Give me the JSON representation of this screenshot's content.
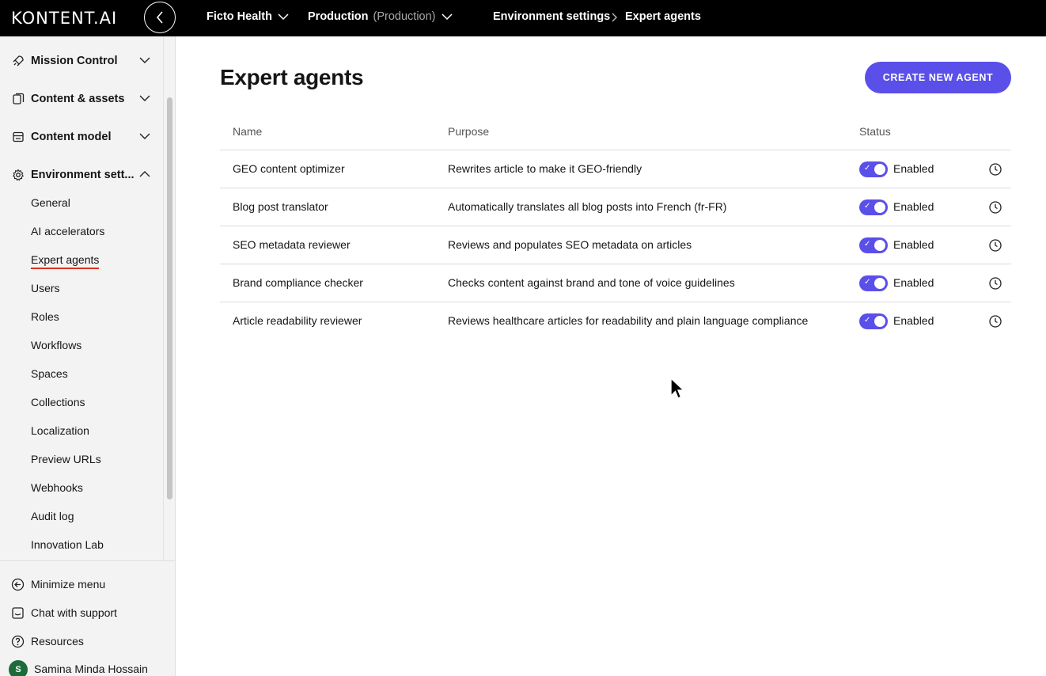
{
  "header": {
    "logo": "KONTENT.AI",
    "project": "Ficto Health",
    "environment": "Production",
    "environment_type": "(Production)",
    "breadcrumb": [
      "Environment settings",
      "Expert agents"
    ]
  },
  "sidebar": {
    "groups": [
      {
        "label": "Mission Control",
        "icon": "rocket-icon",
        "expanded": false
      },
      {
        "label": "Content & assets",
        "icon": "files-icon",
        "expanded": false
      },
      {
        "label": "Content model",
        "icon": "model-icon",
        "expanded": false
      },
      {
        "label": "Environment sett...",
        "icon": "gear-icon",
        "expanded": true
      }
    ],
    "sub_items": [
      "General",
      "AI accelerators",
      "Expert agents",
      "Users",
      "Roles",
      "Workflows",
      "Spaces",
      "Collections",
      "Localization",
      "Preview URLs",
      "Webhooks",
      "Audit log",
      "Innovation Lab"
    ],
    "active_item": "Expert agents",
    "bottom": [
      {
        "label": "Minimize menu",
        "icon": "arrow-left-circle-icon"
      },
      {
        "label": "Chat with support",
        "icon": "chat-icon"
      },
      {
        "label": "Resources",
        "icon": "question-circle-icon"
      }
    ],
    "user": {
      "initial": "S",
      "name": "Samina Minda Hossain"
    }
  },
  "main": {
    "title": "Expert agents",
    "create_button": "CREATE NEW AGENT",
    "columns": [
      "Name",
      "Purpose",
      "Status"
    ],
    "rows": [
      {
        "name": "GEO content optimizer",
        "purpose": "Rewrites article to make it GEO-friendly",
        "status": "Enabled"
      },
      {
        "name": "Blog post translator",
        "purpose": "Automatically translates all blog posts into French (fr-FR)",
        "status": "Enabled"
      },
      {
        "name": "SEO metadata reviewer",
        "purpose": "Reviews and populates SEO metadata on articles",
        "status": "Enabled"
      },
      {
        "name": "Brand compliance checker",
        "purpose": "Checks content against brand and tone of voice guidelines",
        "status": "Enabled"
      },
      {
        "name": "Article readability reviewer",
        "purpose": "Reviews healthcare articles for readability and plain language compliance",
        "status": "Enabled"
      }
    ]
  },
  "colors": {
    "accent": "#5b4fe9",
    "active_underline": "#e0311f",
    "topbar": "#000000",
    "avatar": "#1c6b3a"
  }
}
